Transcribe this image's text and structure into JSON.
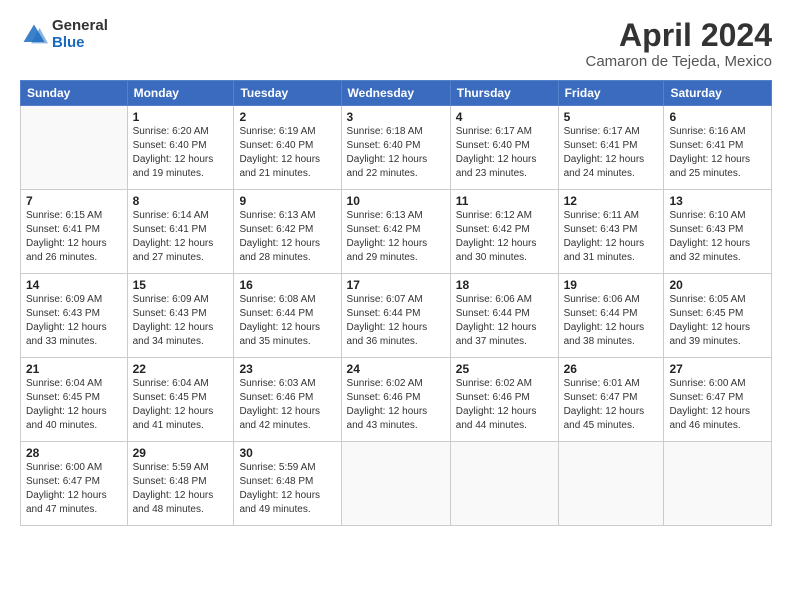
{
  "logo": {
    "general": "General",
    "blue": "Blue"
  },
  "title": "April 2024",
  "subtitle": "Camaron de Tejeda, Mexico",
  "days_header": [
    "Sunday",
    "Monday",
    "Tuesday",
    "Wednesday",
    "Thursday",
    "Friday",
    "Saturday"
  ],
  "weeks": [
    [
      {
        "day": "",
        "detail": ""
      },
      {
        "day": "1",
        "detail": "Sunrise: 6:20 AM\nSunset: 6:40 PM\nDaylight: 12 hours\nand 19 minutes."
      },
      {
        "day": "2",
        "detail": "Sunrise: 6:19 AM\nSunset: 6:40 PM\nDaylight: 12 hours\nand 21 minutes."
      },
      {
        "day": "3",
        "detail": "Sunrise: 6:18 AM\nSunset: 6:40 PM\nDaylight: 12 hours\nand 22 minutes."
      },
      {
        "day": "4",
        "detail": "Sunrise: 6:17 AM\nSunset: 6:40 PM\nDaylight: 12 hours\nand 23 minutes."
      },
      {
        "day": "5",
        "detail": "Sunrise: 6:17 AM\nSunset: 6:41 PM\nDaylight: 12 hours\nand 24 minutes."
      },
      {
        "day": "6",
        "detail": "Sunrise: 6:16 AM\nSunset: 6:41 PM\nDaylight: 12 hours\nand 25 minutes."
      }
    ],
    [
      {
        "day": "7",
        "detail": "Sunrise: 6:15 AM\nSunset: 6:41 PM\nDaylight: 12 hours\nand 26 minutes."
      },
      {
        "day": "8",
        "detail": "Sunrise: 6:14 AM\nSunset: 6:41 PM\nDaylight: 12 hours\nand 27 minutes."
      },
      {
        "day": "9",
        "detail": "Sunrise: 6:13 AM\nSunset: 6:42 PM\nDaylight: 12 hours\nand 28 minutes."
      },
      {
        "day": "10",
        "detail": "Sunrise: 6:13 AM\nSunset: 6:42 PM\nDaylight: 12 hours\nand 29 minutes."
      },
      {
        "day": "11",
        "detail": "Sunrise: 6:12 AM\nSunset: 6:42 PM\nDaylight: 12 hours\nand 30 minutes."
      },
      {
        "day": "12",
        "detail": "Sunrise: 6:11 AM\nSunset: 6:43 PM\nDaylight: 12 hours\nand 31 minutes."
      },
      {
        "day": "13",
        "detail": "Sunrise: 6:10 AM\nSunset: 6:43 PM\nDaylight: 12 hours\nand 32 minutes."
      }
    ],
    [
      {
        "day": "14",
        "detail": "Sunrise: 6:09 AM\nSunset: 6:43 PM\nDaylight: 12 hours\nand 33 minutes."
      },
      {
        "day": "15",
        "detail": "Sunrise: 6:09 AM\nSunset: 6:43 PM\nDaylight: 12 hours\nand 34 minutes."
      },
      {
        "day": "16",
        "detail": "Sunrise: 6:08 AM\nSunset: 6:44 PM\nDaylight: 12 hours\nand 35 minutes."
      },
      {
        "day": "17",
        "detail": "Sunrise: 6:07 AM\nSunset: 6:44 PM\nDaylight: 12 hours\nand 36 minutes."
      },
      {
        "day": "18",
        "detail": "Sunrise: 6:06 AM\nSunset: 6:44 PM\nDaylight: 12 hours\nand 37 minutes."
      },
      {
        "day": "19",
        "detail": "Sunrise: 6:06 AM\nSunset: 6:44 PM\nDaylight: 12 hours\nand 38 minutes."
      },
      {
        "day": "20",
        "detail": "Sunrise: 6:05 AM\nSunset: 6:45 PM\nDaylight: 12 hours\nand 39 minutes."
      }
    ],
    [
      {
        "day": "21",
        "detail": "Sunrise: 6:04 AM\nSunset: 6:45 PM\nDaylight: 12 hours\nand 40 minutes."
      },
      {
        "day": "22",
        "detail": "Sunrise: 6:04 AM\nSunset: 6:45 PM\nDaylight: 12 hours\nand 41 minutes."
      },
      {
        "day": "23",
        "detail": "Sunrise: 6:03 AM\nSunset: 6:46 PM\nDaylight: 12 hours\nand 42 minutes."
      },
      {
        "day": "24",
        "detail": "Sunrise: 6:02 AM\nSunset: 6:46 PM\nDaylight: 12 hours\nand 43 minutes."
      },
      {
        "day": "25",
        "detail": "Sunrise: 6:02 AM\nSunset: 6:46 PM\nDaylight: 12 hours\nand 44 minutes."
      },
      {
        "day": "26",
        "detail": "Sunrise: 6:01 AM\nSunset: 6:47 PM\nDaylight: 12 hours\nand 45 minutes."
      },
      {
        "day": "27",
        "detail": "Sunrise: 6:00 AM\nSunset: 6:47 PM\nDaylight: 12 hours\nand 46 minutes."
      }
    ],
    [
      {
        "day": "28",
        "detail": "Sunrise: 6:00 AM\nSunset: 6:47 PM\nDaylight: 12 hours\nand 47 minutes."
      },
      {
        "day": "29",
        "detail": "Sunrise: 5:59 AM\nSunset: 6:48 PM\nDaylight: 12 hours\nand 48 minutes."
      },
      {
        "day": "30",
        "detail": "Sunrise: 5:59 AM\nSunset: 6:48 PM\nDaylight: 12 hours\nand 49 minutes."
      },
      {
        "day": "",
        "detail": ""
      },
      {
        "day": "",
        "detail": ""
      },
      {
        "day": "",
        "detail": ""
      },
      {
        "day": "",
        "detail": ""
      }
    ]
  ]
}
